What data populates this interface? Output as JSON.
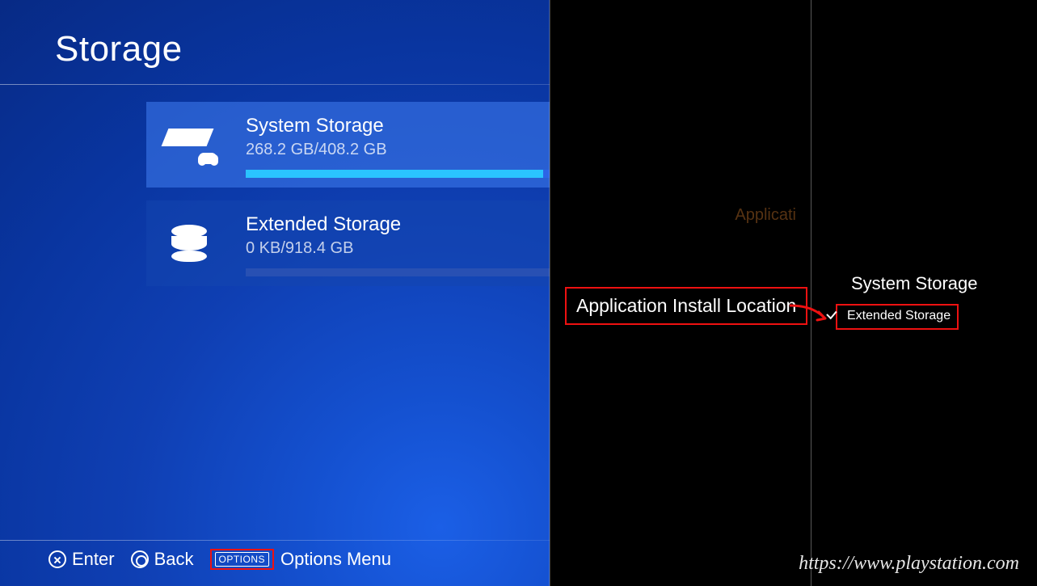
{
  "header": {
    "title": "Storage"
  },
  "storage_items": [
    {
      "id": "system",
      "name": "System Storage",
      "used": "268.2 GB",
      "total": "408.2 GB",
      "sub": "268.2 GB/408.2 GB",
      "fill_pct": 65.7,
      "selected": true,
      "icon": "console-icon"
    },
    {
      "id": "extended",
      "name": "Extended Storage",
      "used": "0 KB",
      "total": "918.4 GB",
      "sub": "0 KB/918.4 GB",
      "fill_pct": 0,
      "selected": false,
      "icon": "db-icon"
    }
  ],
  "hints": {
    "enter": "Enter",
    "back": "Back",
    "options_btn": "OPTIONS",
    "options_label": "Options Menu"
  },
  "options_menu": {
    "ghost_text": "Applicati",
    "items": [
      {
        "label": "Application Install Location",
        "highlight": true
      }
    ]
  },
  "install_location_submenu": {
    "items": [
      {
        "label": "System Storage",
        "selected": false
      },
      {
        "label": "Extended Storage",
        "selected": true,
        "highlight": true
      }
    ]
  },
  "annotations": {
    "arrow_color": "#e11",
    "box_color": "#e11"
  },
  "watermark": "https://www.playstation.com"
}
